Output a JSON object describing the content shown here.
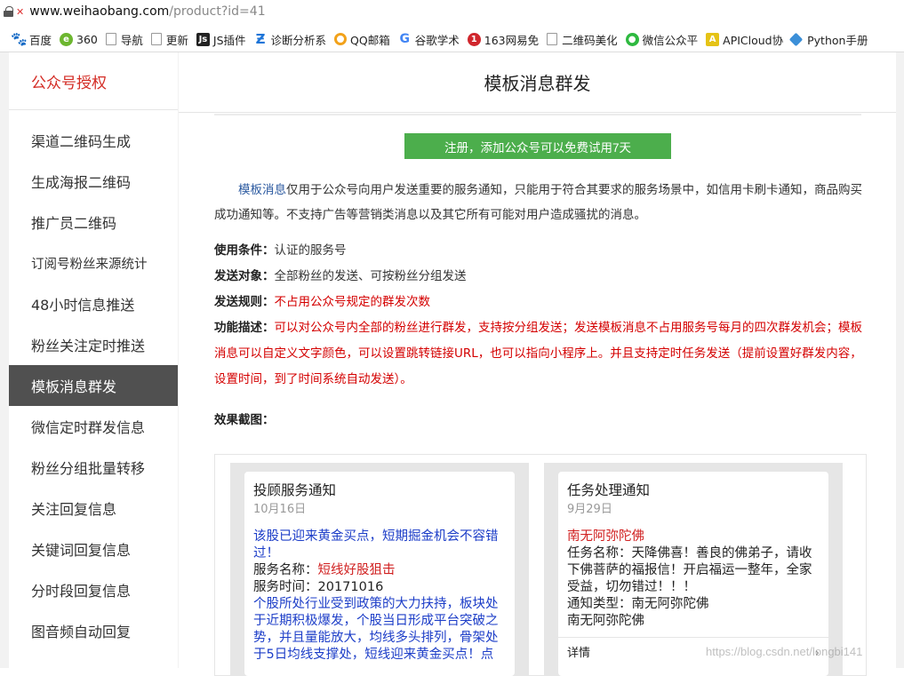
{
  "browser": {
    "url_host": "www.weihaobang.com",
    "url_path": "/product?id=41",
    "bookmarks": [
      {
        "label": "百度",
        "icon": "baidu-paw-icon"
      },
      {
        "label": "360",
        "icon": "360-icon"
      },
      {
        "label": "导航",
        "icon": "page-icon"
      },
      {
        "label": "更新",
        "icon": "page-icon"
      },
      {
        "label": "JS插件",
        "icon": "js-icon"
      },
      {
        "label": "诊断分析系",
        "icon": "diagnosis-icon"
      },
      {
        "label": "QQ邮箱",
        "icon": "qq-mail-icon"
      },
      {
        "label": "谷歌学术",
        "icon": "google-icon"
      },
      {
        "label": "163网易免",
        "icon": "netease-163-icon"
      },
      {
        "label": "二维码美化",
        "icon": "page-icon"
      },
      {
        "label": "微信公众平",
        "icon": "wechat-icon"
      },
      {
        "label": "APICloud协",
        "icon": "apicloud-icon"
      },
      {
        "label": "Python手册",
        "icon": "python-icon"
      }
    ]
  },
  "sidebar": {
    "brand": "公众号授权",
    "items": [
      {
        "label": "渠道二维码生成"
      },
      {
        "label": "生成海报二维码"
      },
      {
        "label": "推广员二维码"
      },
      {
        "label": "订阅号粉丝来源统计"
      },
      {
        "label": "48小时信息推送"
      },
      {
        "label": "粉丝关注定时推送"
      },
      {
        "label": "模板消息群发",
        "active": true
      },
      {
        "label": "微信定时群发信息"
      },
      {
        "label": "粉丝分组批量转移"
      },
      {
        "label": "关注回复信息"
      },
      {
        "label": "关键词回复信息"
      },
      {
        "label": "分时段回复信息"
      },
      {
        "label": "图音频自动回复"
      }
    ]
  },
  "main": {
    "title": "模板消息群发",
    "register_button": "注册，添加公众号可以免费试用7天",
    "intro_keyword": "模板消息",
    "intro_rest": "仅用于公众号向用户发送重要的服务通知，只能用于符合其要求的服务场景中，如信用卡刷卡通知，商品购买成功通知等。不支持广告等营销类消息以及其它所有可能对用户造成骚扰的消息。",
    "spec": {
      "condition_label": "使用条件：",
      "condition_value": "认证的服务号",
      "target_label": "发送对象：",
      "target_value": "全部粉丝的发送、可按粉丝分组发送",
      "rule_label": "发送规则：",
      "rule_value": "不占用公众号规定的群发次数",
      "function_label": "功能描述：",
      "function_value": "可以对公众号内全部的粉丝进行群发，支持按分组发送；发送模板消息不占用服务号每月的四次群发机会；模板消息可以自定义文字颜色，可以设置跳转链接URL，也可以指向小程序上。并且支持定时任务发送（提前设置好群发内容，设置时间，到了时间系统自动发送）。"
    },
    "shots_title": "效果截图："
  },
  "screenshots": [
    {
      "title": "投顾服务通知",
      "date": "10月16日",
      "first": "该股已迎来黄金买点，短期掘金机会不容错过！",
      "name_label": "服务名称：",
      "name_value": "短线好股狙击",
      "time_label": "服务时间：",
      "time_value": "20171016",
      "remark": "个股所处行业受到政策的大力扶持，板块处于近期积极爆发，个股当日形成平台突破之势，并且量能放大，均线多头排列，骨架处于5日均线支撑处，短线迎来黄金买点！点"
    },
    {
      "title": "任务处理通知",
      "date": "9月29日",
      "first": "南无阿弥陀佛",
      "task_label": "任务名称：",
      "task_value": "天降佛喜！善良的佛弟子，请收下佛菩萨的福报信！开启福运一整年，全家受益，切勿错过！！！",
      "type_label": "通知类型：",
      "type_value": "南无阿弥陀佛",
      "remark": "南无阿弥陀佛",
      "detail": "详情"
    }
  ],
  "watermark": "https://blog.csdn.net/longbi141",
  "colors": {
    "brand_red": "#d32b24",
    "button_green": "#4cae4c",
    "active_gray": "#505050",
    "link_blue": "#2c5aa0"
  }
}
